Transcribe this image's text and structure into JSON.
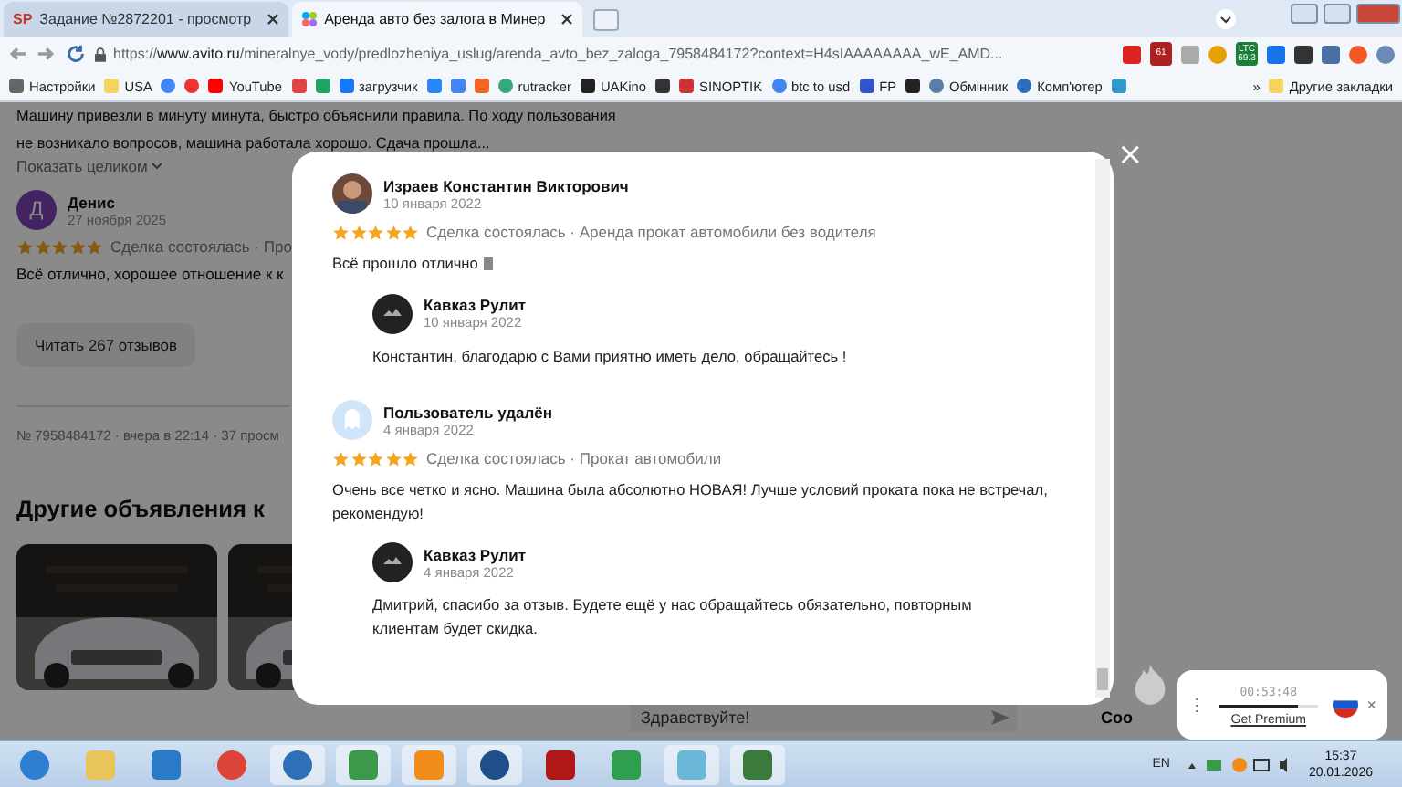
{
  "tabs": [
    {
      "label": "Задание №2872201 - просмотр",
      "favicon_text": "SP",
      "selected": false
    },
    {
      "label": "Аренда авто без залога в Минер",
      "selected": true
    }
  ],
  "address": {
    "scheme": "https://",
    "host": "www.avito.ru",
    "rest": "/mineralnye_vody/predlozheniya_uslug/arenda_avto_bez_zaloga_7958484172?context=H4sIAAAAAAAA_wE_AMD..."
  },
  "extension_badges": [
    {
      "badge": "61"
    },
    {
      "label": "LTC",
      "badge": "69.3"
    }
  ],
  "bookmarks": [
    "Настройки",
    "USA",
    "YouTube",
    "загрузчик",
    "rutracker",
    "UAKino",
    "SINOPTIK",
    "btc to usd",
    "FP",
    "Обмінник",
    "Комп'ютер"
  ],
  "bookmarks_more": "»",
  "other_bookmarks": "Другие закладки",
  "page": {
    "excerpt": "Машину привезли в минуту минута, быстро объяснили правила. По ходу пользования не возникало вопросов, машина работала хорошо. Сдача прошла...",
    "show_more": "Показать целиком",
    "review": {
      "initial": "Д",
      "name": "Денис",
      "date": "27 ноября 2025",
      "stars": 5,
      "meta": "Сделка состоялась · Про",
      "text": "Всё отлично, хорошее отношение к к"
    },
    "read_all": "Читать 267 отзывов",
    "listing_meta": "№ 7958484172 · вчера в 22:14 · 37 просм",
    "other_title": "Другие объявления к",
    "chat_value": "Здравствуйте!",
    "side_text": "Соо"
  },
  "modal": {
    "close": "×",
    "reviews": [
      {
        "author": "Израев Константин Викторович",
        "date": "10 января 2022",
        "stars": 5,
        "meta": "Сделка состоялась · Аренда прокат автомобили без водителя",
        "text": "Всё прошло отлично",
        "reply": {
          "author": "Кавказ Рулит",
          "date": "10 января 2022",
          "text": "Константин, благодарю с Вами приятно иметь дело, обращайтесь !"
        }
      },
      {
        "author": "Пользователь удалён",
        "date": "4 января 2022",
        "stars": 5,
        "meta": "Сделка состоялась · Прокат автомобили",
        "text": "Очень все четко и ясно. Машина была абсолютно НОВАЯ! Лучше условий проката пока не встречал, рекомендую!",
        "reply": {
          "author": "Кавказ Рулит",
          "date": "4 января 2022",
          "text": "Дмитрий, спасибо за отзыв. Будете ещё у нас обращайтесь обязательно, повторным клиентам будет скидка."
        }
      }
    ]
  },
  "vpn": {
    "menu": "⋮",
    "timer": "00:53:48",
    "level": 0.8,
    "link": "Get Premium",
    "close": "×"
  },
  "taskbar": {
    "lang": "EN",
    "time": "15:37",
    "date": "20.01.2026"
  }
}
